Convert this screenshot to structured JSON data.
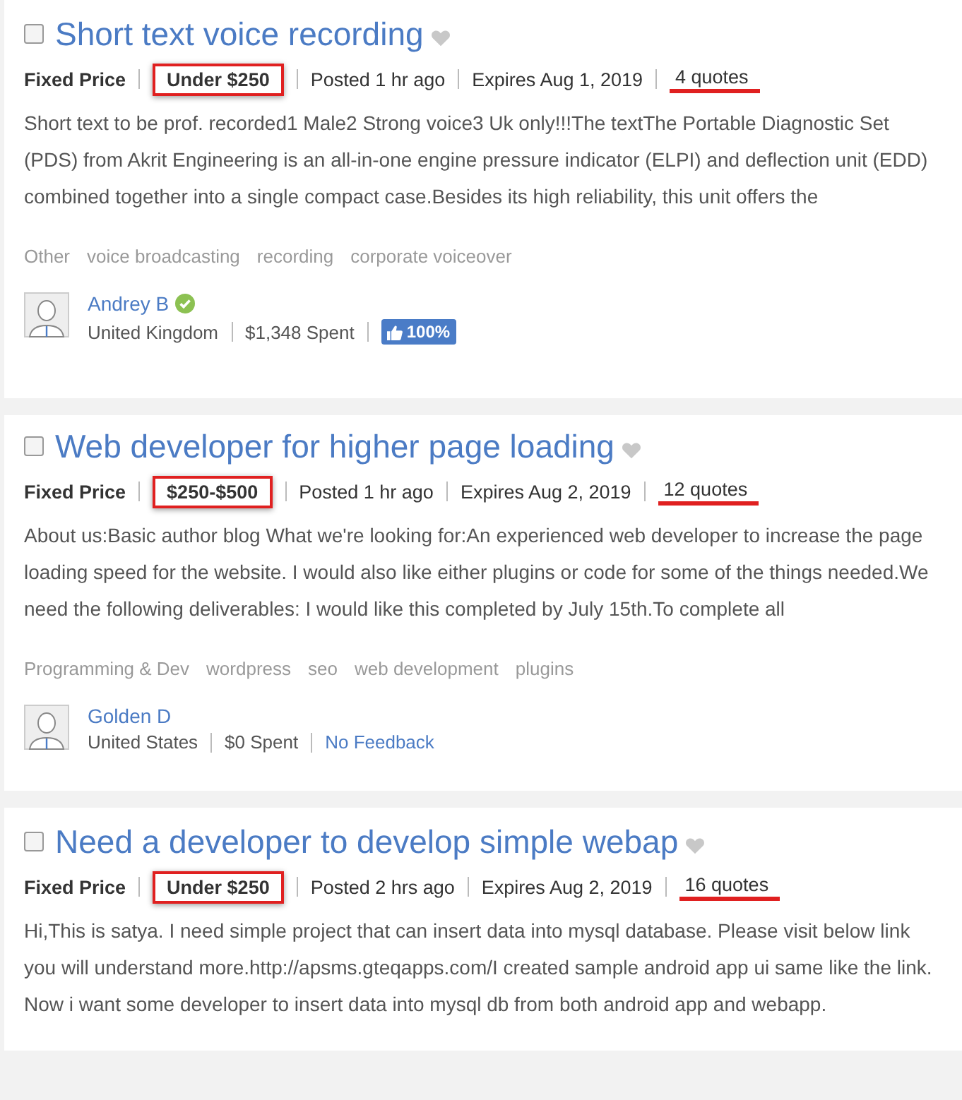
{
  "jobs": [
    {
      "title": "Short text voice recording",
      "checked": false,
      "type": "Fixed Price",
      "budget": "Under $250",
      "posted": "Posted 1 hr ago",
      "expires": "Expires Aug 1, 2019",
      "quotes": "4 quotes",
      "description": "Short text to be prof. recorded1 Male2 Strong voice3 Uk only!!!The textThe Portable Diagnostic Set (PDS) from Akrit Engineering is an all-in-one engine pressure indicator (ELPI) and deflection unit (EDD) combined together into a single compact case.Besides its high reliability, this unit offers the",
      "tags": [
        "Other",
        "voice broadcasting",
        "recording",
        "corporate voiceover"
      ],
      "client": {
        "name": "Andrey B",
        "verified": true,
        "country": "United Kingdom",
        "spent": "$1,348 Spent",
        "feedback": {
          "kind": "rating",
          "text": "100%"
        }
      }
    },
    {
      "title": "Web developer for higher page loading",
      "checked": false,
      "type": "Fixed Price",
      "budget": "$250-$500",
      "posted": "Posted 1 hr ago",
      "expires": "Expires Aug 2, 2019",
      "quotes": "12 quotes",
      "description": "About us:Basic author blog What we're looking for:An experienced web developer to increase the page loading speed for the website. I would also like either plugins or code for some of the things needed.We need the following deliverables: I would like this completed by July 15th.To complete all",
      "tags": [
        "Programming & Dev",
        "wordpress",
        "seo",
        "web development",
        "plugins"
      ],
      "client": {
        "name": "Golden D",
        "verified": false,
        "country": "United States",
        "spent": "$0 Spent",
        "feedback": {
          "kind": "link",
          "text": "No Feedback"
        }
      }
    },
    {
      "title": "Need a developer to develop simple webap",
      "checked": false,
      "type": "Fixed Price",
      "budget": "Under $250",
      "posted": "Posted 2 hrs ago",
      "expires": "Expires Aug 2, 2019",
      "quotes": "16 quotes",
      "description": "Hi,This is satya. I need simple project that can insert data into mysql database. Please visit below link you will understand more.http://apsms.gteqapps.com/I created sample android app ui same like the link. Now i want some developer to insert data into mysql db from both android app and webapp."
    }
  ]
}
